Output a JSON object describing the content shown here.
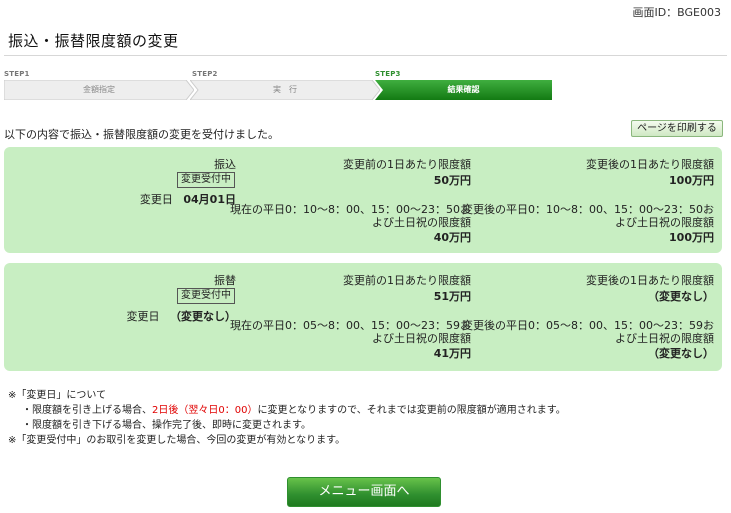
{
  "screen_id": "画面ID：BGE003",
  "page_title": "振込・振替限度額の変更",
  "steps": [
    {
      "label": "STEP1",
      "text": "金額指定",
      "active": false
    },
    {
      "label": "STEP2",
      "text": "実　行",
      "active": false
    },
    {
      "label": "STEP3",
      "text": "結果確認",
      "active": true
    }
  ],
  "notice": "以下の内容で振込・振替限度額の変更を受付けました。",
  "print_button": "ページを印刷する",
  "panels": [
    {
      "type": "振込",
      "status": "変更受付中",
      "change_date_label": "変更日",
      "change_date": "04月01日",
      "before_daily_label": "変更前の1日あたり限度額",
      "before_daily_value": "50万円",
      "after_daily_label": "変更後の1日あたり限度額",
      "after_daily_value": "100万円",
      "before_time_line1": "現在の平日0：10〜8：00、15：00〜23：50お",
      "before_time_line2": "よび土日祝の限度額",
      "before_time_value": "40万円",
      "after_time_line1": "変更後の平日0：10〜8：00、15：00〜23：50お",
      "after_time_line2": "よび土日祝の限度額",
      "after_time_value": "100万円"
    },
    {
      "type": "振替",
      "status": "変更受付中",
      "change_date_label": "変更日",
      "change_date": "（変更なし）",
      "before_daily_label": "変更前の1日あたり限度額",
      "before_daily_value": "51万円",
      "after_daily_label": "変更後の1日あたり限度額",
      "after_daily_value": "（変更なし）",
      "before_time_line1": "現在の平日0：05〜8：00、15：00〜23：59お",
      "before_time_line2": "よび土日祝の限度額",
      "before_time_value": "41万円",
      "after_time_line1": "変更後の平日0：05〜8：00、15：00〜23：59お",
      "after_time_line2": "よび土日祝の限度額",
      "after_time_value": "（変更なし）"
    }
  ],
  "notes": {
    "heading": "※「変更日」について",
    "line1_pre": "・限度額を引き上げる場合、",
    "line1_red": "2日後（翌々日0：00）",
    "line1_post": "に変更となりますので、それまでは変更前の限度額が適用されます。",
    "line2": "・限度額を引き下げる場合、操作完了後、即時に変更されます。",
    "line3": "※「変更受付中」のお取引を変更した場合、今回の変更が有効となります。"
  },
  "menu_button": "メニュー画面へ",
  "colors": {
    "accent_green": "#2f8f2f",
    "panel_bg": "#c8eec2",
    "highlight_red": "#e00000"
  }
}
